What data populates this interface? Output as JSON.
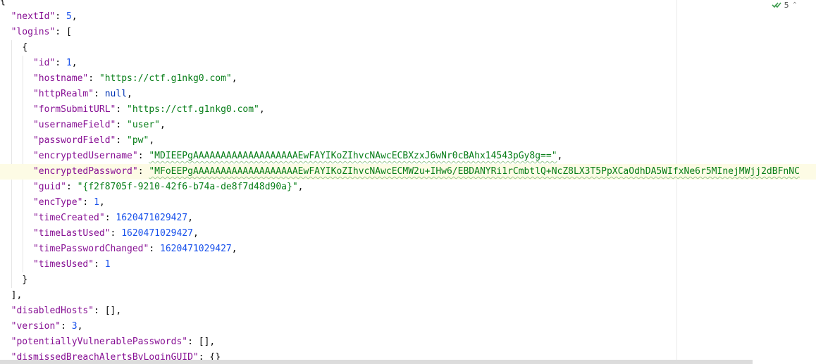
{
  "inspection": {
    "count": "5",
    "icon": "double-check-icon",
    "expand_icon": "chevron-up-icon",
    "color": "#3b9b4c"
  },
  "json": {
    "open_brace": "{",
    "nextId": {
      "key": "\"nextId\"",
      "value": "5"
    },
    "logins_key": "\"logins\"",
    "open_bracket": "[",
    "entry_open": "{",
    "fields": {
      "id": {
        "key": "\"id\"",
        "value": "1"
      },
      "hostname": {
        "key": "\"hostname\"",
        "value": "\"https://ctf.g1nkg0.com\""
      },
      "httpRealm": {
        "key": "\"httpRealm\"",
        "value": "null"
      },
      "formSubmitURL": {
        "key": "\"formSubmitURL\"",
        "value": "\"https://ctf.g1nkg0.com\""
      },
      "usernameField": {
        "key": "\"usernameField\"",
        "value": "\"user\""
      },
      "passwordField": {
        "key": "\"passwordField\"",
        "value": "\"pw\""
      },
      "encryptedUsername": {
        "key": "\"encryptedUsername\"",
        "value": "\"MDIEEPgAAAAAAAAAAAAAAAAAAAEwFAYIKoZIhvcNAwcECBXzxJ6wNr0cBAhx14543pGy8g==\""
      },
      "encryptedPassword": {
        "key": "\"encryptedPassword\"",
        "value": "\"MFoEEPgAAAAAAAAAAAAAAAAAAAEwFAYIKoZIhvcNAwcECMW2u+IHw6/EBDANYRi1rCmbtlQ+NcZ8LX3T5PpXCaOdhDA5WIfxNe6r5MInejMWjj2dBFnNC"
      },
      "guid": {
        "key": "\"guid\"",
        "value": "\"{f2f8705f-9210-42f6-b74a-de8f7d48d90a}\""
      },
      "encType": {
        "key": "\"encType\"",
        "value": "1"
      },
      "timeCreated": {
        "key": "\"timeCreated\"",
        "value": "1620471029427"
      },
      "timeLastUsed": {
        "key": "\"timeLastUsed\"",
        "value": "1620471029427"
      },
      "timePasswordChanged": {
        "key": "\"timePasswordChanged\"",
        "value": "1620471029427"
      },
      "timesUsed": {
        "key": "\"timesUsed\"",
        "value": "1"
      }
    },
    "entry_close": "}",
    "close_bracket": "],",
    "disabledHosts": {
      "key": "\"disabledHosts\"",
      "value": "[]"
    },
    "version": {
      "key": "\"version\"",
      "value": "3"
    },
    "potentiallyVulnerablePasswords": {
      "key": "\"potentiallyVulnerablePasswords\"",
      "value": "[]"
    },
    "dismissedBreachAlertsByLoginGUID": {
      "key": "\"dismissedBreachAlertsByLoginGUID\"",
      "value": "{}"
    }
  },
  "colors": {
    "key": "#871094",
    "string": "#067d17",
    "number": "#1750eb",
    "keyword": "#0033b3",
    "current_line": "#fdfbe5"
  }
}
